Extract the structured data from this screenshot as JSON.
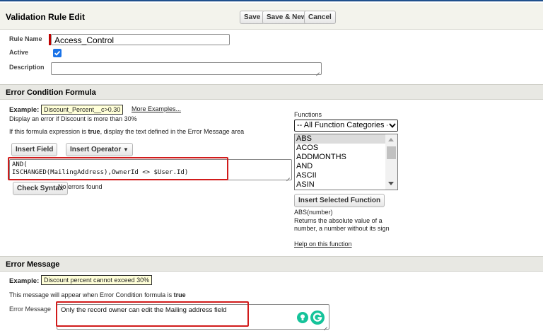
{
  "header": {
    "title": "Validation Rule Edit",
    "save_label": "Save",
    "save_new_label": "Save & New",
    "cancel_label": "Cancel"
  },
  "rule": {
    "name_label": "Rule Name",
    "name_value": "Access_Control",
    "active_label": "Active",
    "active_checked": true,
    "description_label": "Description",
    "description_value": ""
  },
  "formula_section": {
    "title": "Error Condition Formula",
    "example_label": "Example:",
    "example_value": "Discount_Percent__c>0.30",
    "more_examples": "More Examples...",
    "line1": "Display an error if Discount is more than 30%",
    "line2_pre": "If this formula expression is ",
    "line2_bold": "true",
    "line2_post": ", display the text defined in the Error Message area",
    "insert_field": "Insert Field",
    "insert_operator": "Insert Operator",
    "formula_line1": "AND(",
    "formula_line2": "ISCHANGED(MailingAddress),OwnerId <> $User.Id)",
    "check_syntax": "Check Syntax",
    "syntax_status": "No errors found"
  },
  "functions": {
    "label": "Functions",
    "category_selected": "-- All Function Categories --",
    "items": [
      "ABS",
      "ACOS",
      "ADDMONTHS",
      "AND",
      "ASCII",
      "ASIN"
    ],
    "selected_index": 0,
    "insert_selected": "Insert Selected Function",
    "signature": "ABS(number)",
    "desc_line1": "Returns the absolute value of a",
    "desc_line2": "number, a number without its sign",
    "help_link": "Help on this function"
  },
  "error_section": {
    "title": "Error Message",
    "example_label": "Example:",
    "example_value": "Discount percent cannot exceed 30%",
    "note_pre": "This message will appear when Error Condition formula is ",
    "note_bold": "true",
    "message_label": "Error Message",
    "message_value": "Only the record owner can edit the Mailing address field"
  },
  "colors": {
    "highlight_red": "#d11b1b",
    "header_bg": "#f3f3ec",
    "grammarly_green": "#15c39a"
  }
}
